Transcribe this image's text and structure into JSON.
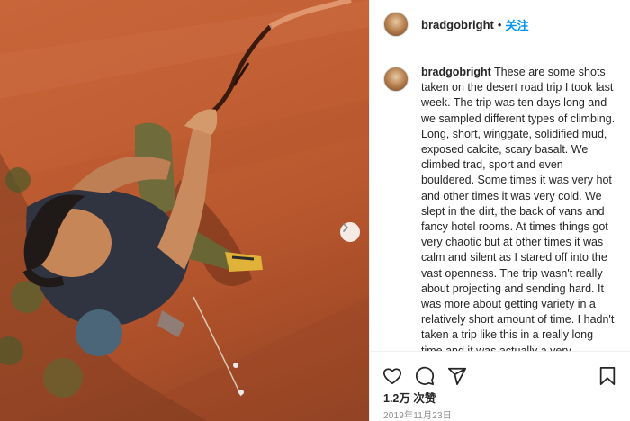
{
  "post": {
    "username": "bradgobright",
    "separator": "•",
    "follow_label": "关注",
    "caption_username": "bradgobright",
    "caption_text": "These are some shots taken on the desert road trip I took last week. The trip was ten days long and we sampled different types of climbing. Long, short, winggate, solidified mud, exposed calcite, scary basalt. We climbed trad, sport and even bouldered. Some times it was very hot and other times it was very cold. We slept in the dirt, the back of vans and fancy hotel rooms. At times things got very chaotic but at other times it was calm and silent as I stared off into the vast openness. The trip wasn't really about projecting and sending hard. It was more about getting variety in a relatively short amount of time. I hadn't taken a trip like this in a really long time and it was actually a very refreshing experience.",
    "likes": "1.2万 次赞",
    "date": "2019年11月23日"
  },
  "icons": {
    "like": "heart-icon",
    "comment": "comment-icon",
    "share": "send-icon",
    "save": "bookmark-icon",
    "next": "chevron-right-icon"
  },
  "colors": {
    "accent": "#0095f6",
    "text": "#262626",
    "muted": "#8e8e8e",
    "rock": "#c25f34"
  }
}
